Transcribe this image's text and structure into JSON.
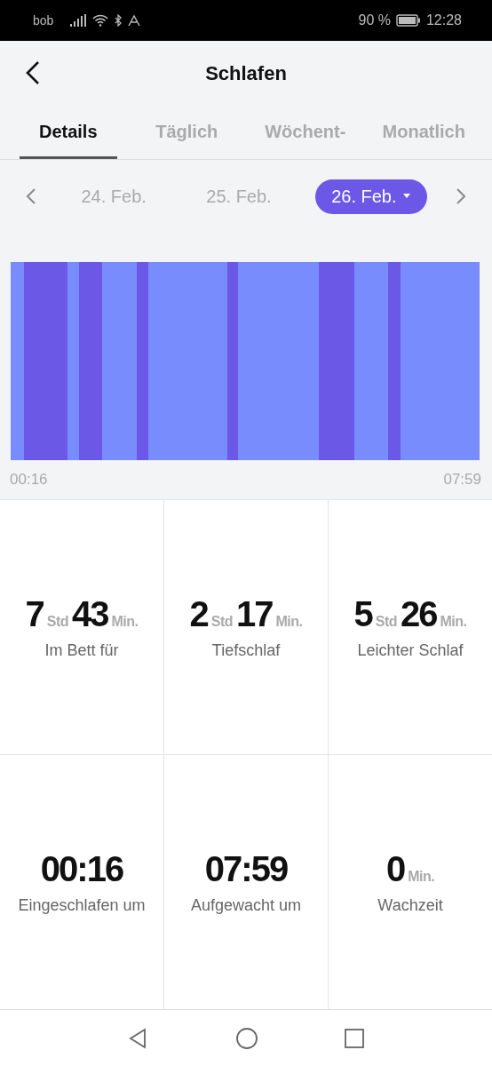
{
  "status_bar": {
    "carrier": "bob",
    "battery": "90 %",
    "time": "12:28"
  },
  "header": {
    "title": "Schlafen"
  },
  "tabs": [
    {
      "label": "Details",
      "selected": true
    },
    {
      "label": "Täglich",
      "selected": false
    },
    {
      "label": "Wöchent-",
      "selected": false
    },
    {
      "label": "Monatlich",
      "selected": false
    }
  ],
  "dates": [
    {
      "label": "24. Feb.",
      "selected": false
    },
    {
      "label": "25. Feb.",
      "selected": false
    },
    {
      "label": "26. Feb.",
      "selected": true
    }
  ],
  "chart": {
    "start": "00:16",
    "end": "07:59"
  },
  "stats": [
    {
      "value": [
        {
          "kind": "number",
          "text": "7"
        },
        {
          "kind": "unit",
          "text": "Std"
        },
        {
          "kind": "number",
          "text": "43"
        },
        {
          "kind": "unit",
          "text": "Min."
        }
      ],
      "label": "Im Bett für"
    },
    {
      "value": [
        {
          "kind": "number",
          "text": "2"
        },
        {
          "kind": "unit",
          "text": "Std"
        },
        {
          "kind": "number",
          "text": "17"
        },
        {
          "kind": "unit",
          "text": "Min."
        }
      ],
      "label": "Tiefschlaf"
    },
    {
      "value": [
        {
          "kind": "number",
          "text": "5"
        },
        {
          "kind": "unit",
          "text": "Std"
        },
        {
          "kind": "number",
          "text": "26"
        },
        {
          "kind": "unit",
          "text": "Min."
        }
      ],
      "label": "Leichter Schlaf"
    },
    {
      "value": [
        {
          "kind": "number",
          "text": "00:16"
        }
      ],
      "label": "Eingeschlafen um"
    },
    {
      "value": [
        {
          "kind": "number",
          "text": "07:59"
        }
      ],
      "label": "Aufgewacht um"
    },
    {
      "value": [
        {
          "kind": "number",
          "text": "0"
        },
        {
          "kind": "unit",
          "text": "Min."
        }
      ],
      "label": "Wachzeit"
    }
  ]
}
